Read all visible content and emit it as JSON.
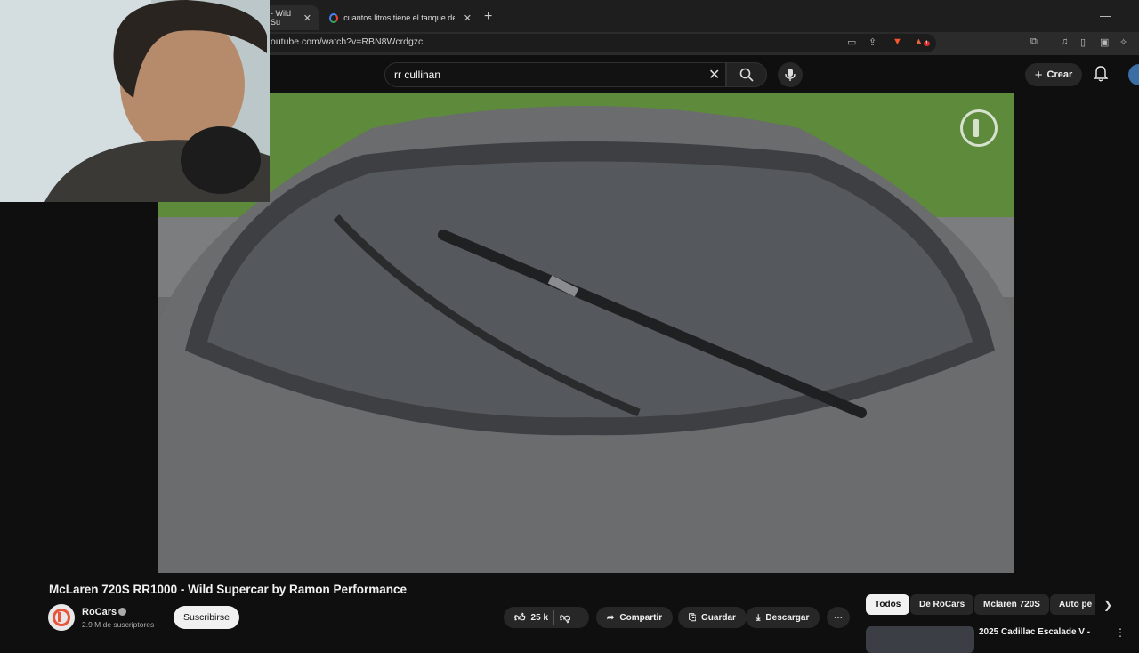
{
  "browser": {
    "tabs": [
      {
        "title": "- Wild Su",
        "active": true
      },
      {
        "title": "cuantos litros tiene el tanque de un culli",
        "active": false
      }
    ],
    "url": "outube.com/watch?v=RBN8Wcrdgzc",
    "extension_badge": "1"
  },
  "youtube": {
    "search": {
      "value": "rr cullinan"
    },
    "create_label": "Crear"
  },
  "video": {
    "title": "McLaren 720S RR1000 - Wild Supercar by Ramon Performance",
    "channel": {
      "name": "RoCars",
      "subscribers": "2.9 M de suscriptores"
    },
    "subscribe_label": "Suscribirse",
    "actions": {
      "likes": "25 k",
      "share": "Compartir",
      "save": "Guardar",
      "download": "Descargar"
    }
  },
  "sidebar": {
    "chips": [
      "Todos",
      "De RoCars",
      "Mclaren 720S",
      "Auto pe"
    ],
    "recommendations": [
      {
        "title": "2025 Cadillac Escalade V -"
      }
    ]
  },
  "colors": {
    "background": "#0f0f0f",
    "chip_active": "#f1f1f1",
    "badge_red": "#d32f2f"
  }
}
